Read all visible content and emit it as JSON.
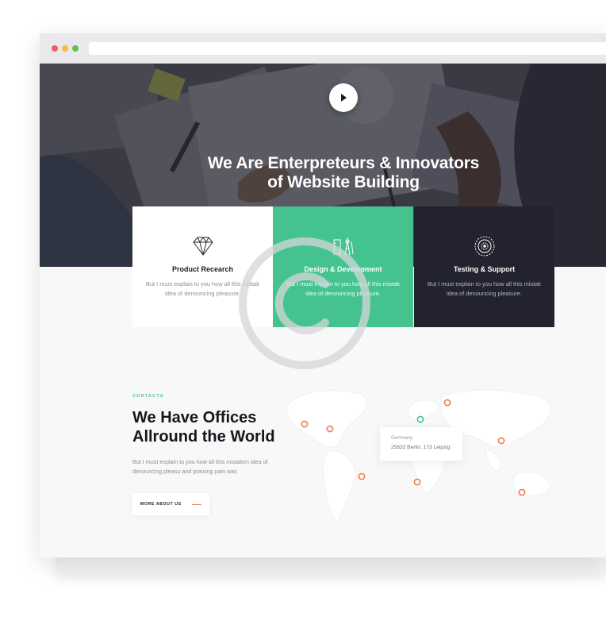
{
  "hero": {
    "title_line1": "We Are Enterpreteurs & Innovators",
    "title_line2": "of Website Building"
  },
  "services": [
    {
      "title": "Product Recearch",
      "description": "But I must explain to you how all this mistak idea of denouncing pleasure.",
      "icon": "diamond-icon",
      "bg": "#ffffff"
    },
    {
      "title": "Design & Development",
      "description": "But I must explain to you how all this mistak idea of denouncing pleasure.",
      "icon": "design-tools-icon",
      "bg": "#45c38f"
    },
    {
      "title": "Testing & Support",
      "description": "But I must explain to you how all this mistak idea of denouncing pleasure.",
      "icon": "target-circles-icon",
      "bg": "#22232f"
    }
  ],
  "contacts": {
    "kicker": "CONTACTS",
    "title_line1": "We Have Offices",
    "title_line2": "Allround the World",
    "body": "But I must explain to you how all this mistaken idea of denouncing pleasu and praising pain was",
    "button_label": "MORE ABOUT US"
  },
  "office_card": {
    "country": "Germany",
    "address": "25632 Berlin, 173 Leipzig"
  },
  "colors": {
    "accent_green": "#45c38f",
    "dark_navy": "#22232f",
    "marker_orange": "#f07a55"
  }
}
